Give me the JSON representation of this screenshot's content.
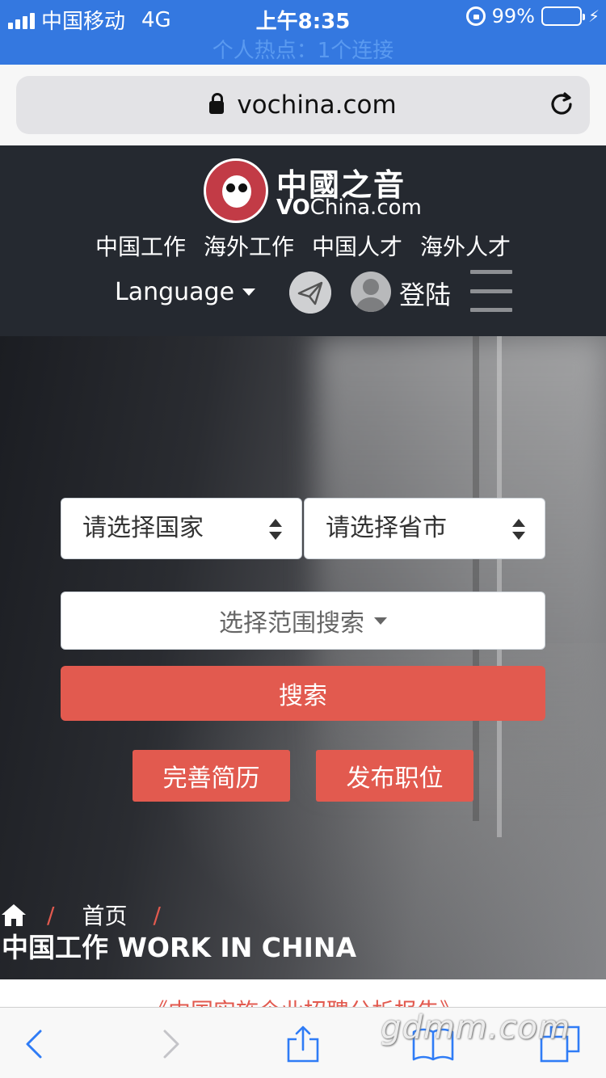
{
  "status_bar": {
    "carrier": "中国移动",
    "network": "4G",
    "time": "上午8:35",
    "battery": "99%",
    "hotspot": "个人热点：1个连接"
  },
  "browser": {
    "url": "vochina.com"
  },
  "header": {
    "logo_cn": "中國之音",
    "logo_vo": "VO",
    "logo_rest": "China.com",
    "nav": [
      "中国工作",
      "海外工作",
      "中国人才",
      "海外人才"
    ],
    "language_label": "Language",
    "login_label": "登陆"
  },
  "search": {
    "country_placeholder": "请选择国家",
    "province_placeholder": "请选择省市",
    "range_label": "选择范围搜索",
    "search_button": "搜索",
    "resume_button": "完善简历",
    "post_job_button": "发布职位"
  },
  "breadcrumb": {
    "home": "首页",
    "separator": "/",
    "page_title": "中国工作 WORK IN CHINA"
  },
  "content_peek": "《中国实施企业招聘分析报告》",
  "watermark": "gdmm.com",
  "colors": {
    "status_bar": "#3478e0",
    "header_bg": "#252930",
    "accent": "#e25a4f",
    "toolbar_icon": "#2f7cf6"
  },
  "icons": {
    "reload": "reload-icon",
    "padlock": "padlock-icon",
    "plane": "paper-plane-icon",
    "user": "user-avatar-icon",
    "menu": "hamburger-icon",
    "home": "home-icon",
    "back": "back-icon",
    "forward": "forward-icon",
    "share": "share-icon",
    "bookmarks": "bookmarks-icon",
    "tabs": "tabs-icon"
  }
}
